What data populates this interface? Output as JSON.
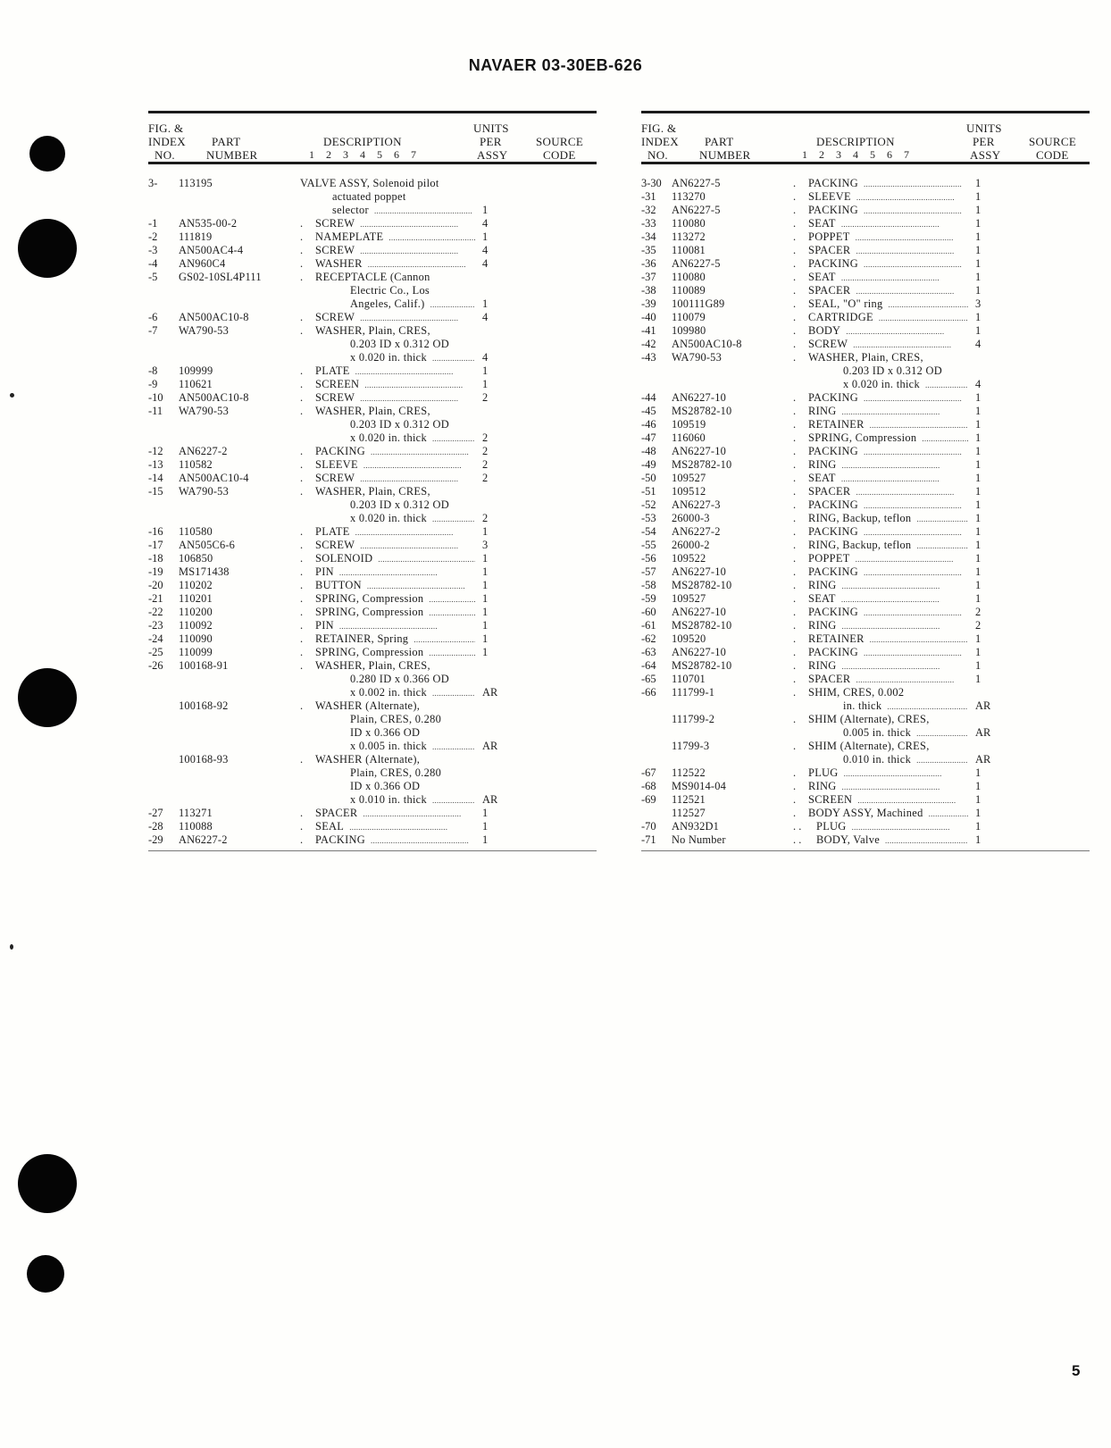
{
  "document": {
    "title": "NAVAER 03-30EB-626",
    "page_number": "5"
  },
  "table_header": {
    "fig_line1": "FIG. &",
    "fig_line2": "INDEX",
    "fig_line3": "NO.",
    "part_line1": "PART",
    "part_line2": "NUMBER",
    "description": "DESCRIPTION",
    "levels": "1 2 3 4 5 6 7",
    "units_line1": "UNITS",
    "units_line2": "PER",
    "units_line3": "ASSY",
    "source_line1": "SOURCE",
    "source_line2": "CODE"
  },
  "left_column": [
    {
      "index": "3-",
      "part": "113195",
      "level": 0,
      "desc": [
        "VALVE ASSY, Solenoid pilot",
        "actuated poppet",
        "selector"
      ],
      "units": "1",
      "source": ""
    },
    {
      "index": "-1",
      "part": "AN535-00-2",
      "level": 1,
      "desc": [
        "SCREW"
      ],
      "units": "4",
      "source": ""
    },
    {
      "index": "-2",
      "part": "111819",
      "level": 1,
      "desc": [
        "NAMEPLATE"
      ],
      "units": "1",
      "source": ""
    },
    {
      "index": "-3",
      "part": "AN500AC4-4",
      "level": 1,
      "desc": [
        "SCREW"
      ],
      "units": "4",
      "source": ""
    },
    {
      "index": "-4",
      "part": "AN960C4",
      "level": 1,
      "desc": [
        "WASHER"
      ],
      "units": "4",
      "source": ""
    },
    {
      "index": "-5",
      "part": "GS02-10SL4P111",
      "level": 1,
      "desc": [
        "RECEPTACLE (Cannon",
        "Electric Co., Los",
        "Angeles, Calif.)"
      ],
      "units": "1",
      "source": ""
    },
    {
      "index": "-6",
      "part": "AN500AC10-8",
      "level": 1,
      "desc": [
        "SCREW"
      ],
      "units": "4",
      "source": ""
    },
    {
      "index": "-7",
      "part": "WA790-53",
      "level": 1,
      "desc": [
        "WASHER, Plain, CRES,",
        "0.203 ID x 0.312 OD",
        "x 0.020 in. thick"
      ],
      "units": "4",
      "source": ""
    },
    {
      "index": "-8",
      "part": "109999",
      "level": 1,
      "desc": [
        "PLATE"
      ],
      "units": "1",
      "source": ""
    },
    {
      "index": "-9",
      "part": "110621",
      "level": 1,
      "desc": [
        "SCREEN"
      ],
      "units": "1",
      "source": ""
    },
    {
      "index": "-10",
      "part": "AN500AC10-8",
      "level": 1,
      "desc": [
        "SCREW"
      ],
      "units": "2",
      "source": ""
    },
    {
      "index": "-11",
      "part": "WA790-53",
      "level": 1,
      "desc": [
        "WASHER, Plain, CRES,",
        "0.203 ID x 0.312 OD",
        "x 0.020 in. thick"
      ],
      "units": "2",
      "source": ""
    },
    {
      "index": "-12",
      "part": "AN6227-2",
      "level": 1,
      "desc": [
        "PACKING"
      ],
      "units": "2",
      "source": ""
    },
    {
      "index": "-13",
      "part": "110582",
      "level": 1,
      "desc": [
        "SLEEVE"
      ],
      "units": "2",
      "source": ""
    },
    {
      "index": "-14",
      "part": "AN500AC10-4",
      "level": 1,
      "desc": [
        "SCREW"
      ],
      "units": "2",
      "source": ""
    },
    {
      "index": "-15",
      "part": "WA790-53",
      "level": 1,
      "desc": [
        "WASHER, Plain, CRES,",
        "0.203 ID x 0.312 OD",
        "x 0.020 in. thick"
      ],
      "units": "2",
      "source": ""
    },
    {
      "index": "-16",
      "part": "110580",
      "level": 1,
      "desc": [
        "PLATE"
      ],
      "units": "1",
      "source": ""
    },
    {
      "index": "-17",
      "part": "AN505C6-6",
      "level": 1,
      "desc": [
        "SCREW"
      ],
      "units": "3",
      "source": ""
    },
    {
      "index": "-18",
      "part": "106850",
      "level": 1,
      "desc": [
        "SOLENOID"
      ],
      "units": "1",
      "source": ""
    },
    {
      "index": "-19",
      "part": "MS171438",
      "level": 1,
      "desc": [
        "PIN"
      ],
      "units": "1",
      "source": ""
    },
    {
      "index": "-20",
      "part": "110202",
      "level": 1,
      "desc": [
        "BUTTON"
      ],
      "units": "1",
      "source": ""
    },
    {
      "index": "-21",
      "part": "110201",
      "level": 1,
      "desc": [
        "SPRING, Compression"
      ],
      "units": "1",
      "source": ""
    },
    {
      "index": "-22",
      "part": "110200",
      "level": 1,
      "desc": [
        "SPRING, Compression"
      ],
      "units": "1",
      "source": ""
    },
    {
      "index": "-23",
      "part": "110092",
      "level": 1,
      "desc": [
        "PIN"
      ],
      "units": "1",
      "source": ""
    },
    {
      "index": "-24",
      "part": "110090",
      "level": 1,
      "desc": [
        "RETAINER, Spring"
      ],
      "units": "1",
      "source": ""
    },
    {
      "index": "-25",
      "part": "110099",
      "level": 1,
      "desc": [
        "SPRING, Compression"
      ],
      "units": "1",
      "source": ""
    },
    {
      "index": "-26",
      "part": "100168-91",
      "level": 1,
      "desc": [
        "WASHER, Plain, CRES,",
        "0.280 ID x 0.366 OD",
        "x 0.002 in. thick"
      ],
      "units": "AR",
      "source": ""
    },
    {
      "index": "",
      "part": "100168-92",
      "level": 1,
      "desc": [
        "WASHER (Alternate),",
        "Plain, CRES, 0.280",
        "ID x 0.366 OD",
        "x 0.005 in. thick"
      ],
      "units": "AR",
      "source": ""
    },
    {
      "index": "",
      "part": "100168-93",
      "level": 1,
      "desc": [
        "WASHER (Alternate),",
        "Plain, CRES, 0.280",
        "ID x 0.366 OD",
        "x 0.010 in. thick"
      ],
      "units": "AR",
      "source": ""
    },
    {
      "index": "-27",
      "part": "113271",
      "level": 1,
      "desc": [
        "SPACER"
      ],
      "units": "1",
      "source": ""
    },
    {
      "index": "-28",
      "part": "110088",
      "level": 1,
      "desc": [
        "SEAL"
      ],
      "units": "1",
      "source": ""
    },
    {
      "index": "-29",
      "part": "AN6227-2",
      "level": 1,
      "desc": [
        "PACKING"
      ],
      "units": "1",
      "source": ""
    }
  ],
  "right_column": [
    {
      "index": "3-30",
      "part": "AN6227-5",
      "level": 1,
      "desc": [
        "PACKING"
      ],
      "units": "1",
      "source": ""
    },
    {
      "index": "-31",
      "part": "113270",
      "level": 1,
      "desc": [
        "SLEEVE"
      ],
      "units": "1",
      "source": ""
    },
    {
      "index": "-32",
      "part": "AN6227-5",
      "level": 1,
      "desc": [
        "PACKING"
      ],
      "units": "1",
      "source": ""
    },
    {
      "index": "-33",
      "part": "110080",
      "level": 1,
      "desc": [
        "SEAT"
      ],
      "units": "1",
      "source": ""
    },
    {
      "index": "-34",
      "part": "113272",
      "level": 1,
      "desc": [
        "POPPET"
      ],
      "units": "1",
      "source": ""
    },
    {
      "index": "-35",
      "part": "110081",
      "level": 1,
      "desc": [
        "SPACER"
      ],
      "units": "1",
      "source": ""
    },
    {
      "index": "-36",
      "part": "AN6227-5",
      "level": 1,
      "desc": [
        "PACKING"
      ],
      "units": "1",
      "source": ""
    },
    {
      "index": "-37",
      "part": "110080",
      "level": 1,
      "desc": [
        "SEAT"
      ],
      "units": "1",
      "source": ""
    },
    {
      "index": "-38",
      "part": "110089",
      "level": 1,
      "desc": [
        "SPACER"
      ],
      "units": "1",
      "source": ""
    },
    {
      "index": "-39",
      "part": "100111G89",
      "level": 1,
      "desc": [
        "SEAL, \"O\" ring"
      ],
      "units": "3",
      "source": ""
    },
    {
      "index": "-40",
      "part": "110079",
      "level": 1,
      "desc": [
        "CARTRIDGE"
      ],
      "units": "1",
      "source": ""
    },
    {
      "index": "-41",
      "part": "109980",
      "level": 1,
      "desc": [
        "BODY"
      ],
      "units": "1",
      "source": ""
    },
    {
      "index": "-42",
      "part": "AN500AC10-8",
      "level": 1,
      "desc": [
        "SCREW"
      ],
      "units": "4",
      "source": ""
    },
    {
      "index": "-43",
      "part": "WA790-53",
      "level": 1,
      "desc": [
        "WASHER, Plain, CRES,",
        "0.203 ID x 0.312 OD",
        "x 0.020 in. thick"
      ],
      "units": "4",
      "source": ""
    },
    {
      "index": "-44",
      "part": "AN6227-10",
      "level": 1,
      "desc": [
        "PACKING"
      ],
      "units": "1",
      "source": ""
    },
    {
      "index": "-45",
      "part": "MS28782-10",
      "level": 1,
      "desc": [
        "RING"
      ],
      "units": "1",
      "source": ""
    },
    {
      "index": "-46",
      "part": "109519",
      "level": 1,
      "desc": [
        "RETAINER"
      ],
      "units": "1",
      "source": ""
    },
    {
      "index": "-47",
      "part": "116060",
      "level": 1,
      "desc": [
        "SPRING, Compression"
      ],
      "units": "1",
      "source": ""
    },
    {
      "index": "-48",
      "part": "AN6227-10",
      "level": 1,
      "desc": [
        "PACKING"
      ],
      "units": "1",
      "source": ""
    },
    {
      "index": "-49",
      "part": "MS28782-10",
      "level": 1,
      "desc": [
        "RING"
      ],
      "units": "1",
      "source": ""
    },
    {
      "index": "-50",
      "part": "109527",
      "level": 1,
      "desc": [
        "SEAT"
      ],
      "units": "1",
      "source": ""
    },
    {
      "index": "-51",
      "part": "109512",
      "level": 1,
      "desc": [
        "SPACER"
      ],
      "units": "1",
      "source": ""
    },
    {
      "index": "-52",
      "part": "AN6227-3",
      "level": 1,
      "desc": [
        "PACKING"
      ],
      "units": "1",
      "source": ""
    },
    {
      "index": "-53",
      "part": "26000-3",
      "level": 1,
      "desc": [
        "RING, Backup, teflon"
      ],
      "units": "1",
      "source": ""
    },
    {
      "index": "-54",
      "part": "AN6227-2",
      "level": 1,
      "desc": [
        "PACKING"
      ],
      "units": "1",
      "source": ""
    },
    {
      "index": "-55",
      "part": "26000-2",
      "level": 1,
      "desc": [
        "RING, Backup, teflon"
      ],
      "units": "1",
      "source": ""
    },
    {
      "index": "-56",
      "part": "109522",
      "level": 1,
      "desc": [
        "POPPET"
      ],
      "units": "1",
      "source": ""
    },
    {
      "index": "-57",
      "part": "AN6227-10",
      "level": 1,
      "desc": [
        "PACKING"
      ],
      "units": "1",
      "source": ""
    },
    {
      "index": "-58",
      "part": "MS28782-10",
      "level": 1,
      "desc": [
        "RING"
      ],
      "units": "1",
      "source": ""
    },
    {
      "index": "-59",
      "part": "109527",
      "level": 1,
      "desc": [
        "SEAT"
      ],
      "units": "1",
      "source": ""
    },
    {
      "index": "-60",
      "part": "AN6227-10",
      "level": 1,
      "desc": [
        "PACKING"
      ],
      "units": "2",
      "source": ""
    },
    {
      "index": "-61",
      "part": "MS28782-10",
      "level": 1,
      "desc": [
        "RING"
      ],
      "units": "2",
      "source": ""
    },
    {
      "index": "-62",
      "part": "109520",
      "level": 1,
      "desc": [
        "RETAINER"
      ],
      "units": "1",
      "source": ""
    },
    {
      "index": "-63",
      "part": "AN6227-10",
      "level": 1,
      "desc": [
        "PACKING"
      ],
      "units": "1",
      "source": ""
    },
    {
      "index": "-64",
      "part": "MS28782-10",
      "level": 1,
      "desc": [
        "RING"
      ],
      "units": "1",
      "source": ""
    },
    {
      "index": "-65",
      "part": "110701",
      "level": 1,
      "desc": [
        "SPACER"
      ],
      "units": "1",
      "source": ""
    },
    {
      "index": "-66",
      "part": "111799-1",
      "level": 1,
      "desc": [
        "SHIM, CRES, 0.002",
        "in. thick"
      ],
      "units": "AR",
      "source": ""
    },
    {
      "index": "",
      "part": "111799-2",
      "level": 1,
      "desc": [
        "SHIM (Alternate), CRES,",
        "0.005 in. thick"
      ],
      "units": "AR",
      "source": ""
    },
    {
      "index": "",
      "part": "11799-3",
      "level": 1,
      "desc": [
        "SHIM (Alternate), CRES,",
        "0.010 in. thick"
      ],
      "units": "AR",
      "source": ""
    },
    {
      "index": "-67",
      "part": "112522",
      "level": 1,
      "desc": [
        "PLUG"
      ],
      "units": "1",
      "source": ""
    },
    {
      "index": "-68",
      "part": "MS9014-04",
      "level": 1,
      "desc": [
        "RING"
      ],
      "units": "1",
      "source": ""
    },
    {
      "index": "-69",
      "part": "112521",
      "level": 1,
      "desc": [
        "SCREEN"
      ],
      "units": "1",
      "source": ""
    },
    {
      "index": "",
      "part": "112527",
      "level": 1,
      "desc": [
        "BODY ASSY, Machined"
      ],
      "units": "1",
      "source": ""
    },
    {
      "index": "-70",
      "part": "AN932D1",
      "level": 2,
      "desc": [
        "PLUG"
      ],
      "units": "1",
      "source": ""
    },
    {
      "index": "-71",
      "part": "No Number",
      "level": 2,
      "desc": [
        "BODY, Valve"
      ],
      "units": "1",
      "source": ""
    }
  ]
}
